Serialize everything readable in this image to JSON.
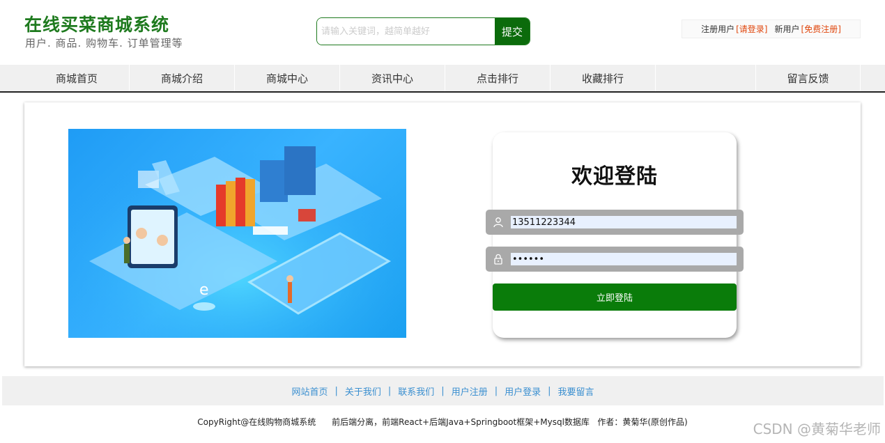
{
  "header": {
    "title": "在线买菜商城系统",
    "subtitle": "用户. 商品. 购物车. 订单管理等",
    "search_placeholder": "请输入关键词，越简单越好",
    "search_button": "提交",
    "user": {
      "registered_label": "注册用户",
      "login_link": "[请登录]",
      "new_label": "新用户",
      "register_link": "[免费注册]"
    }
  },
  "nav": {
    "items": [
      "商城首页",
      "商城介绍",
      "商城中心",
      "资讯中心",
      "点击排行",
      "收藏排行"
    ],
    "last": "留言反馈"
  },
  "login": {
    "title": "欢迎登陆",
    "username_value": "13511223344",
    "password_value": "••••••",
    "button": "立即登陆"
  },
  "illustration": {
    "colors": {
      "background": "#2aa5ff",
      "accent": "#7fd4ff"
    }
  },
  "footer": {
    "links": [
      "网站首页",
      "关于我们",
      "联系我们",
      "用户注册",
      "用户登录",
      "我要留言"
    ],
    "copyright": "CopyRight@在线购物商城系统      前后端分离，前端React+后端Java+Springboot框架+Mysql数据库   作者：黄菊华(原创作品)"
  },
  "watermark": "CSDN @黄菊华老师",
  "colors": {
    "brand": "#1e7a1e",
    "link": "#3a8fd0",
    "highlight": "#e0470e"
  }
}
